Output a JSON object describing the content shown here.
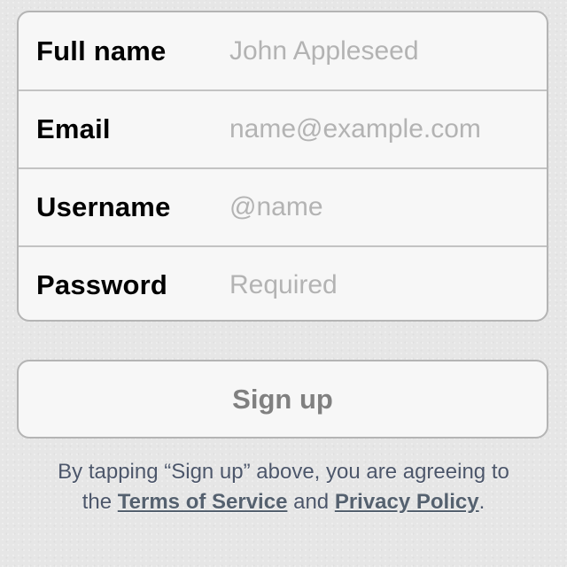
{
  "form": {
    "rows": [
      {
        "label": "Full name",
        "placeholder": "John Appleseed",
        "value": ""
      },
      {
        "label": "Email",
        "placeholder": "name@example.com",
        "value": ""
      },
      {
        "label": "Username",
        "placeholder": "@name",
        "value": ""
      },
      {
        "label": "Password",
        "placeholder": "Required",
        "value": ""
      }
    ]
  },
  "signup_button": {
    "label": "Sign up"
  },
  "legal": {
    "line1": "By tapping “Sign up” above, you are agreeing to",
    "line2_prefix": "the",
    "terms_link": "Terms of Service",
    "conjunction": "and",
    "privacy_link": "Privacy Policy",
    "suffix": "."
  },
  "colors": {
    "background": "#e6e6e6",
    "card": "#f7f7f7",
    "border": "#b4b4b4",
    "placeholder": "#b3b3b3",
    "button_text": "#808080",
    "legal_text": "#4c566a"
  }
}
